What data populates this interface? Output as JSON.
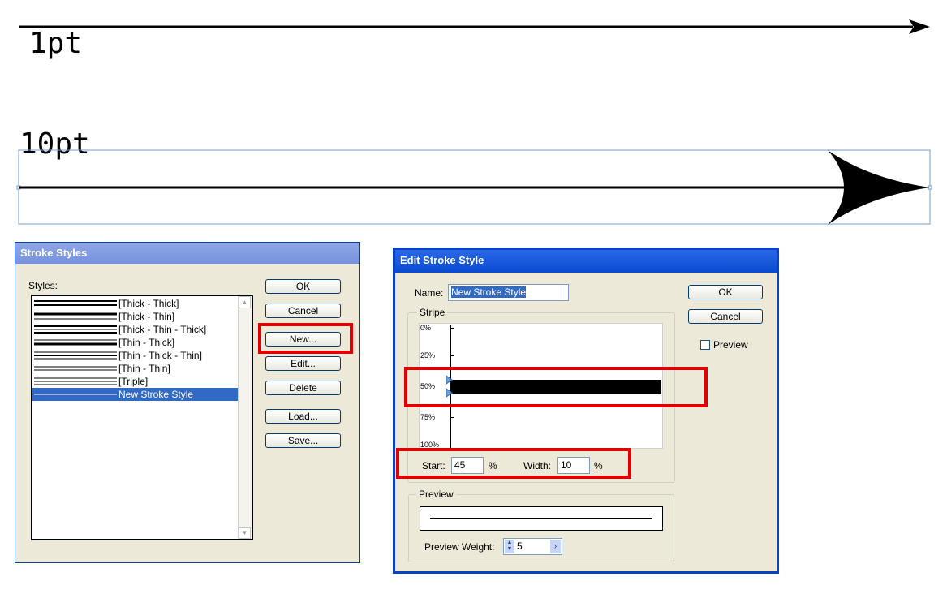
{
  "canvas": {
    "label_1pt": "1pt",
    "label_10pt": "10pt"
  },
  "stroke_styles": {
    "title": "Stroke Styles",
    "styles_label": "Styles:",
    "items": [
      {
        "label": "[Thick - Thick]",
        "selected": false
      },
      {
        "label": "[Thick - Thin]",
        "selected": false
      },
      {
        "label": "[Thick - Thin - Thick]",
        "selected": false
      },
      {
        "label": "[Thin - Thick]",
        "selected": false
      },
      {
        "label": "[Thin - Thick - Thin]",
        "selected": false
      },
      {
        "label": "[Thin - Thin]",
        "selected": false
      },
      {
        "label": "[Triple]",
        "selected": false
      },
      {
        "label": "New Stroke Style",
        "selected": true
      }
    ],
    "buttons": {
      "ok": "OK",
      "cancel": "Cancel",
      "new": "New...",
      "edit": "Edit...",
      "delete": "Delete",
      "load": "Load...",
      "save": "Save..."
    }
  },
  "edit_stroke_style": {
    "title": "Edit Stroke Style",
    "name_label": "Name:",
    "name_value": "New Stroke Style",
    "stripe_label": "Stripe",
    "ruler": [
      "0%",
      "25%",
      "50%",
      "75%",
      "100%"
    ],
    "start_label": "Start:",
    "start_value": "45",
    "width_label": "Width:",
    "width_value": "10",
    "percent": "%",
    "preview_group_label": "Preview",
    "preview_weight_label": "Preview Weight:",
    "preview_weight_value": "5",
    "preview_checkbox_label": "Preview",
    "preview_checked": false,
    "buttons": {
      "ok": "OK",
      "cancel": "Cancel"
    }
  },
  "colors": {
    "highlight": "#e00000",
    "selection": "#316ac5",
    "dialog_bg": "#ece9d8",
    "title_bar": "#0a5fd8"
  }
}
